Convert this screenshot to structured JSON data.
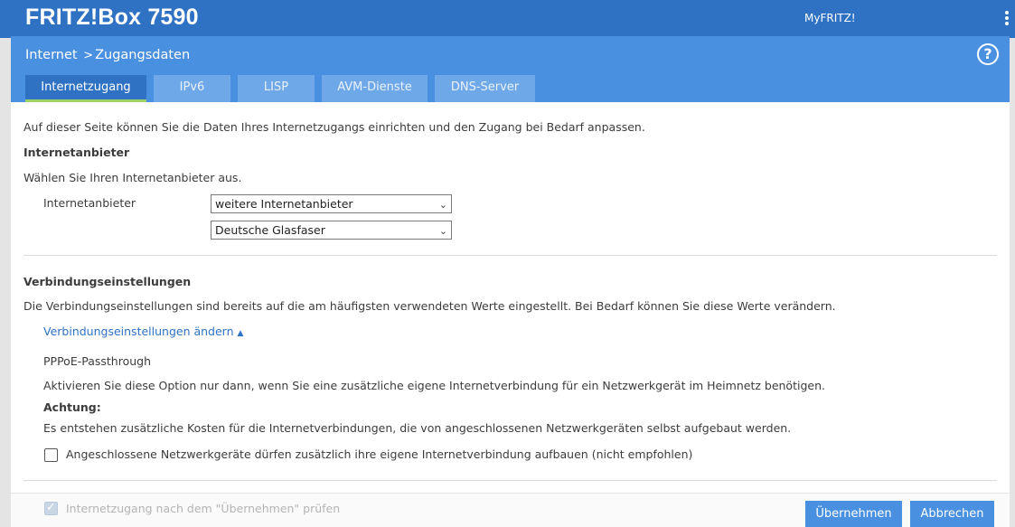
{
  "app": {
    "brand": "FRITZ!Box 7590",
    "myfritz_label": "MyFRITZ!"
  },
  "header": {
    "breadcrumb_root": "Internet",
    "breadcrumb_separator": ">",
    "breadcrumb_page": "Zugangsdaten",
    "help_label": "?"
  },
  "tabs": [
    {
      "label": "Internetzugang",
      "active": true
    },
    {
      "label": "IPv6",
      "active": false
    },
    {
      "label": "LISP",
      "active": false
    },
    {
      "label": "AVM-Dienste",
      "active": false
    },
    {
      "label": "DNS-Server",
      "active": false
    }
  ],
  "main": {
    "intro": "Auf dieser Seite können Sie die Daten Ihres Internetzugangs einrichten und den Zugang bei Bedarf anpassen.",
    "provider": {
      "heading": "Internetanbieter",
      "instruction": "Wählen Sie Ihren Internetanbieter aus.",
      "field_label": "Internetanbieter",
      "select1_value": "weitere Internetanbieter",
      "select2_value": "Deutsche Glasfaser"
    },
    "connection": {
      "heading": "Verbindungseinstellungen",
      "description": "Die Verbindungseinstellungen sind bereits auf die am häufigsten verwendeten Werte eingestellt. Bei Bedarf können Sie diese Werte verändern.",
      "toggle_link": "Verbindungseinstellungen ändern",
      "pppoe_title": "PPPoE-Passthrough",
      "pppoe_desc": "Aktivieren Sie diese Option nur dann, wenn Sie eine zusätzliche eigene Internetverbindung für ein Netzwerkgerät im Heimnetz benötigen.",
      "warning_label": "Achtung:",
      "warning_text": "Es entstehen zusätzliche Kosten für die Internetverbindungen, die von angeschlossenen Netzwerkgeräten selbst aufgebaut werden.",
      "checkbox_label": "Angeschlossene Netzwerkgeräte dürfen zusätzlich ihre eigene Internetverbindung aufbauen (nicht empfohlen)",
      "checkbox_checked": false
    }
  },
  "footer": {
    "check_label": "Internetzugang nach dem \"Übernehmen\" prüfen",
    "check_checked": true,
    "apply_label": "Übernehmen",
    "cancel_label": "Abbrechen"
  }
}
